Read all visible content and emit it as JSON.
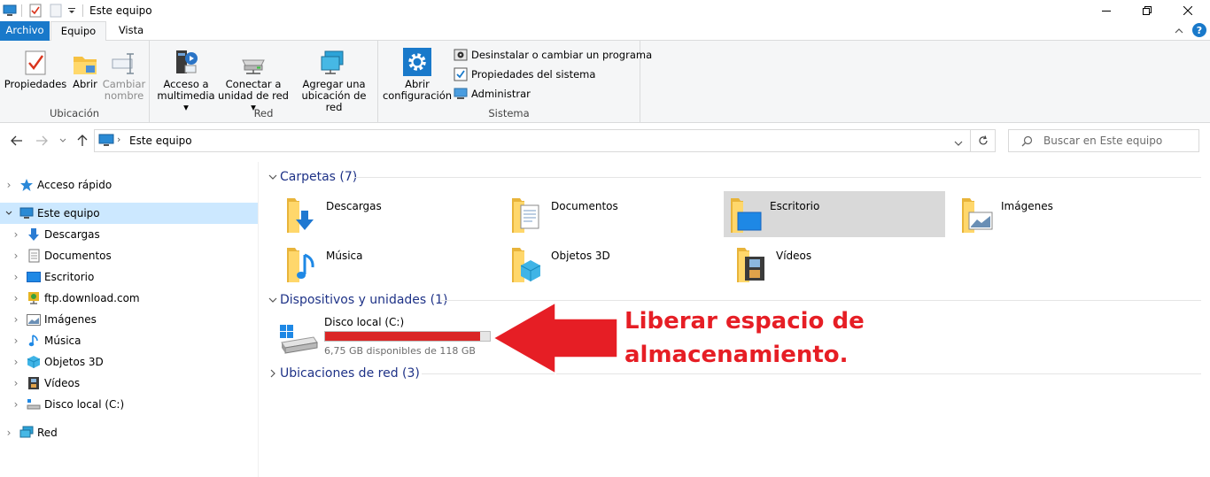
{
  "window": {
    "title": "Este equipo"
  },
  "tabs": {
    "archivo": "Archivo",
    "equipo": "Equipo",
    "vista": "Vista"
  },
  "ribbon": {
    "ubicacion": {
      "title": "Ubicación",
      "propiedades": "Propiedades",
      "abrir": "Abrir",
      "cambiar_1": "Cambiar",
      "cambiar_2": "nombre"
    },
    "red": {
      "title": "Red",
      "multimedia_1": "Acceso a",
      "multimedia_2": "multimedia",
      "conectar_1": "Conectar a",
      "conectar_2": "unidad de red",
      "agregar_1": "Agregar una",
      "agregar_2": "ubicación de red"
    },
    "sistema": {
      "title": "Sistema",
      "abrir_config_1": "Abrir",
      "abrir_config_2": "configuración",
      "desinstalar": "Desinstalar o cambiar un programa",
      "propiedades_sistema": "Propiedades del sistema",
      "administrar": "Administrar"
    }
  },
  "address": {
    "path": "Este equipo",
    "search_placeholder": "Buscar en Este equipo"
  },
  "nav": {
    "acceso_rapido": "Acceso rápido",
    "este_equipo": "Este equipo",
    "descargas": "Descargas",
    "documentos": "Documentos",
    "escritorio": "Escritorio",
    "ftp": "ftp.download.com",
    "imagenes": "Imágenes",
    "musica": "Música",
    "objetos3d": "Objetos 3D",
    "videos": "Vídeos",
    "disco": "Disco local (C:)",
    "red": "Red"
  },
  "content": {
    "carpetas_title": "Carpetas (7)",
    "folders": {
      "descargas": "Descargas",
      "documentos": "Documentos",
      "escritorio": "Escritorio",
      "imagenes": "Imágenes",
      "musica": "Música",
      "objetos3d": "Objetos 3D",
      "videos": "Vídeos"
    },
    "dispositivos_title": "Dispositivos y unidades (1)",
    "disk": {
      "name": "Disco local (C:)",
      "free_text": "6,75 GB disponibles de 118 GB",
      "used_fraction": 0.943
    },
    "ubicaciones_title": "Ubicaciones de red (3)"
  },
  "annotation": {
    "line1": "Liberar espacio de",
    "line2": "almacenamiento."
  },
  "colors": {
    "accent": "#1979ca",
    "selection": "#cce8ff",
    "disk_full": "#da2626",
    "annotation": "#e61e25"
  }
}
